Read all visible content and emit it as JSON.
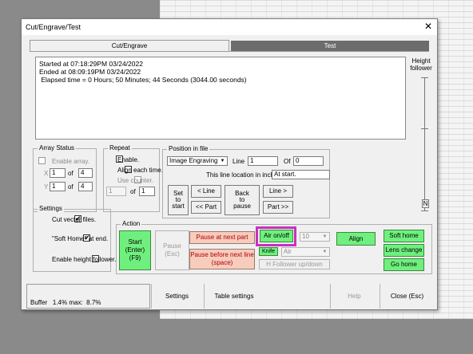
{
  "window": {
    "title": "Cut/Engrave/Test",
    "close_glyph": "✕"
  },
  "tabs": [
    "Cut/Engrave",
    "Test"
  ],
  "log": {
    "lines": [
      "Started at 07:18:29PM 03/24/2022",
      "Ended at 08:09:19PM 03/24/2022",
      " Elapsed time = 0 Hours; 50 Minutes; 44 Seconds (3044.00 seconds)"
    ]
  },
  "height_follower": {
    "label_line1": "Height",
    "label_line2": "follower",
    "n_button": "N"
  },
  "array_status": {
    "title": "Array Status",
    "enable_label": "Enable array.",
    "x_label": "X",
    "x_value": "1",
    "x_of": "of",
    "x_total": "4",
    "y_label": "Y",
    "y_value": "1",
    "y_of": "of",
    "y_total": "4"
  },
  "repeat": {
    "title": "Repeat",
    "enable_label": "Enable.",
    "align_label": "Align each time.",
    "counter_label": "Use counter.",
    "counter_value": "1",
    "counter_of": "of",
    "counter_total": "1"
  },
  "position": {
    "title": "Position in file",
    "mode_value": "Image Engraving",
    "line_label": "Line",
    "line_value": "1",
    "of_label": "Of",
    "of_value": "0",
    "location_label": "This line location in inches",
    "location_value": "At start.",
    "set_to_start": [
      "Set",
      "to",
      "start"
    ],
    "prev_line": "< Line",
    "prev_part": "<< Part",
    "back_to_pause": [
      "Back",
      "to",
      "pause"
    ],
    "next_line": "Line >",
    "next_part": "Part >>"
  },
  "settings_group": {
    "title": "Settings",
    "cut_vector": "Cut vector files.",
    "soft_home": "\"Soft Home\" at end.",
    "height_follower": "Enable height follower."
  },
  "action": {
    "title": "Action",
    "start": [
      "Start",
      "(Enter)(F9)"
    ],
    "pause": [
      "Pause",
      "(Esc)"
    ],
    "pause_next_part": "Pause at next part",
    "pause_next_line": [
      "Pause before next line",
      "(space)"
    ],
    "air": "Air on/off",
    "power_value": "10",
    "knife": "Knife",
    "air_select": "Air",
    "hfollower": "H Follower up/down",
    "align": "Align",
    "soft_home": "Soft home",
    "lens_change": "Lens change",
    "go_home": "Go home",
    "highlight_color": "#c830c0"
  },
  "bottom": {
    "buffer_label": "Buffer",
    "buffer_pct": "1.4%",
    "max_label": "max:",
    "max_pct": "8.7%",
    "settings": "Settings",
    "table_settings": "Table settings",
    "help": "Help",
    "close": "Close (Esc)"
  },
  "colors": {
    "green": "#6ff07e",
    "salmon": "#f7ccbd",
    "salmon_text": "#b00000"
  }
}
